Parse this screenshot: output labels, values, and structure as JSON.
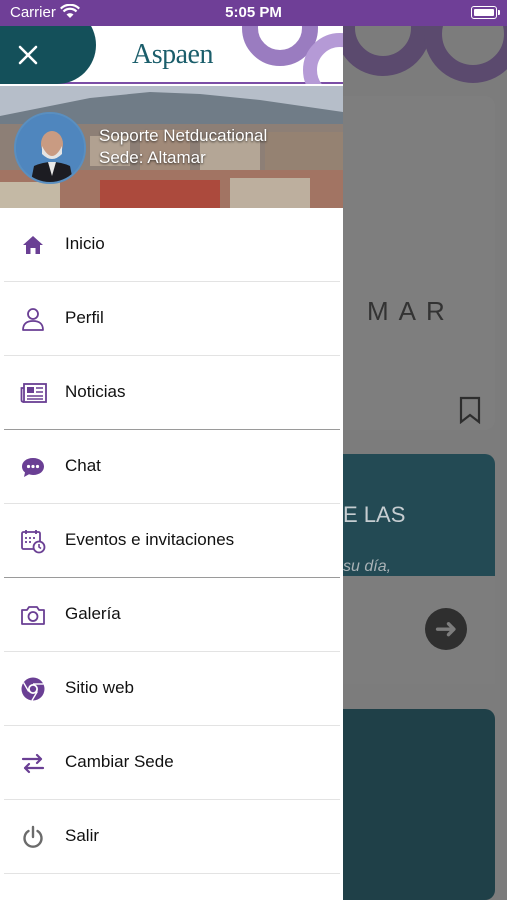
{
  "status_bar": {
    "carrier": "Carrier",
    "time": "5:05 PM"
  },
  "colors": {
    "accent": "#6f3f97",
    "teal": "#14505a",
    "icon": "#6a3f94"
  },
  "header": {
    "logo_text": "Aspaen",
    "close_icon": "close-icon"
  },
  "profile": {
    "name": "Soporte Netducational",
    "site": "Sede: Altamar"
  },
  "menu": {
    "items": [
      {
        "label": "Inicio",
        "icon": "home-icon"
      },
      {
        "label": "Perfil",
        "icon": "person-icon"
      },
      {
        "label": "Noticias",
        "icon": "newspaper-icon"
      },
      {
        "label": "Chat",
        "icon": "chat-icon"
      },
      {
        "label": "Eventos e invitaciones",
        "icon": "calendar-icon"
      },
      {
        "label": "Galería",
        "icon": "camera-icon"
      },
      {
        "label": "Sitio web",
        "icon": "chrome-icon"
      },
      {
        "label": "Cambiar Sede",
        "icon": "swap-icon"
      },
      {
        "label": "Salir",
        "icon": "power-icon"
      }
    ]
  },
  "background": {
    "card1_text": "MAR",
    "card2_text": "E LAS",
    "card2_subtext": "su día,"
  }
}
